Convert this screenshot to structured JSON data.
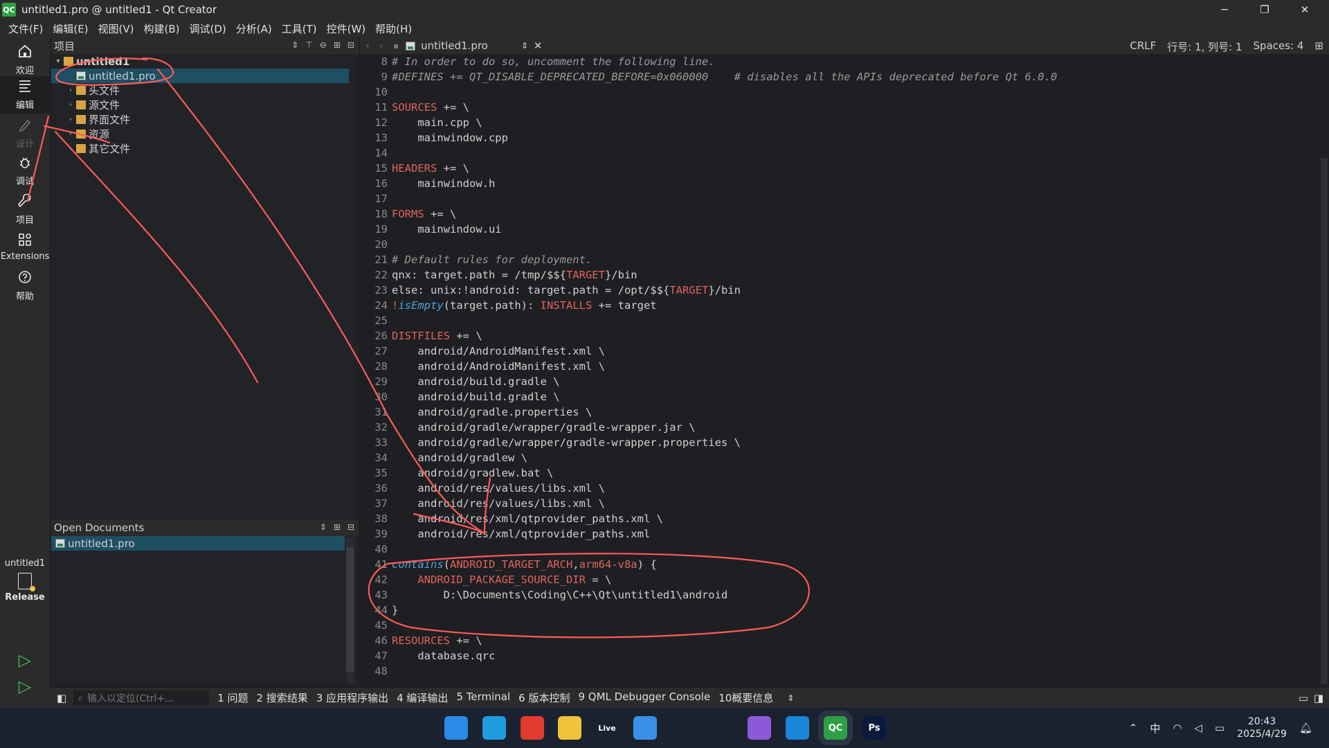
{
  "window": {
    "title": "untitled1.pro @ untitled1 - Qt Creator",
    "app_badge": "QC"
  },
  "menu": [
    "文件(F)",
    "编辑(E)",
    "视图(V)",
    "构建(B)",
    "调试(D)",
    "分析(A)",
    "工具(T)",
    "控件(W)",
    "帮助(H)"
  ],
  "modes": [
    {
      "label": "欢迎",
      "icon": "home-icon"
    },
    {
      "label": "编辑",
      "icon": "edit-lines-icon",
      "selected": true
    },
    {
      "label": "设计",
      "icon": "pencil-icon",
      "disabled": true
    },
    {
      "label": "调试",
      "icon": "bug-icon"
    },
    {
      "label": "项目",
      "icon": "wrench-icon"
    },
    {
      "label": "Extensions",
      "icon": "extensions-icon"
    },
    {
      "label": "帮助",
      "icon": "help-icon"
    }
  ],
  "kit": {
    "project": "untitled1",
    "config": "Release"
  },
  "project_panel": {
    "title": "项目",
    "tree": [
      {
        "label": "untitled1",
        "level": 0,
        "expanded": true,
        "type": "project"
      },
      {
        "label": "untitled1.pro",
        "level": 1,
        "type": "profile",
        "selected": true
      },
      {
        "label": "头文件",
        "level": 1,
        "type": "folder"
      },
      {
        "label": "源文件",
        "level": 1,
        "type": "folder"
      },
      {
        "label": "界面文件",
        "level": 1,
        "type": "folder"
      },
      {
        "label": "资源",
        "level": 1,
        "type": "folder"
      },
      {
        "label": "其它文件",
        "level": 1,
        "type": "folder"
      }
    ]
  },
  "open_documents": {
    "title": "Open Documents",
    "items": [
      "untitled1.pro"
    ]
  },
  "editor": {
    "tab": "untitled1.pro",
    "line_ending": "CRLF",
    "position": "行号: 1, 列号: 1",
    "spaces": "Spaces: 4",
    "lines": [
      {
        "n": "8",
        "t": "# In order to do so, uncomment the following line."
      },
      {
        "n": "9",
        "t": "#DEFINES += QT_DISABLE_DEPRECATED_BEFORE=0x060000    # disables all the APIs deprecated before Qt 6.0.0"
      },
      {
        "n": "10",
        "t": ""
      },
      {
        "n": "11",
        "t": "SOURCES += \\"
      },
      {
        "n": "12",
        "t": "    main.cpp \\"
      },
      {
        "n": "13",
        "t": "    mainwindow.cpp"
      },
      {
        "n": "14",
        "t": ""
      },
      {
        "n": "15",
        "t": "HEADERS += \\"
      },
      {
        "n": "16",
        "t": "    mainwindow.h"
      },
      {
        "n": "17",
        "t": ""
      },
      {
        "n": "18",
        "t": "FORMS += \\"
      },
      {
        "n": "19",
        "t": "    mainwindow.ui"
      },
      {
        "n": "20",
        "t": ""
      },
      {
        "n": "21",
        "t": "# Default rules for deployment."
      },
      {
        "n": "22",
        "t": "qnx: target.path = /tmp/$${TARGET}/bin"
      },
      {
        "n": "23",
        "t": "else: unix:!android: target.path = /opt/$${TARGET}/bin"
      },
      {
        "n": "24",
        "t": "!isEmpty(target.path): INSTALLS += target"
      },
      {
        "n": "25",
        "t": ""
      },
      {
        "n": "26",
        "t": "DISTFILES += \\"
      },
      {
        "n": "27",
        "t": "    android/AndroidManifest.xml \\"
      },
      {
        "n": "28",
        "t": "    android/AndroidManifest.xml \\"
      },
      {
        "n": "29",
        "t": "    android/build.gradle \\"
      },
      {
        "n": "30",
        "t": "    android/build.gradle \\"
      },
      {
        "n": "31",
        "t": "    android/gradle.properties \\"
      },
      {
        "n": "32",
        "t": "    android/gradle/wrapper/gradle-wrapper.jar \\"
      },
      {
        "n": "33",
        "t": "    android/gradle/wrapper/gradle-wrapper.properties \\"
      },
      {
        "n": "34",
        "t": "    android/gradlew \\"
      },
      {
        "n": "35",
        "t": "    android/gradlew.bat \\"
      },
      {
        "n": "36",
        "t": "    android/res/values/libs.xml \\"
      },
      {
        "n": "37",
        "t": "    android/res/values/libs.xml \\"
      },
      {
        "n": "38",
        "t": "    android/res/xml/qtprovider_paths.xml \\"
      },
      {
        "n": "39",
        "t": "    android/res/xml/qtprovider_paths.xml"
      },
      {
        "n": "40",
        "t": ""
      },
      {
        "n": "41",
        "t": "contains(ANDROID_TARGET_ARCH,arm64-v8a) {"
      },
      {
        "n": "42",
        "t": "    ANDROID_PACKAGE_SOURCE_DIR = \\"
      },
      {
        "n": "43",
        "t": "        D:\\Documents\\Coding\\C++\\Qt\\untitled1\\android"
      },
      {
        "n": "44",
        "t": "}"
      },
      {
        "n": "45",
        "t": ""
      },
      {
        "n": "46",
        "t": "RESOURCES += \\"
      },
      {
        "n": "47",
        "t": "    database.qrc"
      },
      {
        "n": "48",
        "t": ""
      }
    ]
  },
  "statusbar": {
    "locator_placeholder": "输入以定位(Ctrl+...",
    "panes": [
      "1 问题",
      "2 搜索结果",
      "3 应用程序输出",
      "4 编译输出",
      "5 Terminal",
      "6 版本控制",
      "9 QML Debugger Console",
      "10概要信息"
    ]
  },
  "taskbar": {
    "apps": [
      {
        "name": "windows-start-icon",
        "label": "",
        "color": "#2a8ae6"
      },
      {
        "name": "edge-icon",
        "label": "",
        "color": "#1f9be0"
      },
      {
        "name": "netease-music-icon",
        "label": "",
        "color": "#e33a2f"
      },
      {
        "name": "file-explorer-icon",
        "label": "",
        "color": "#f2c23a"
      },
      {
        "name": "live-icon",
        "label": "Live",
        "color": "#1a2230"
      },
      {
        "name": "shield-app-icon",
        "label": "",
        "color": "#3b8fe8"
      },
      {
        "name": "steam-icon",
        "label": "",
        "color": "#1a2230"
      },
      {
        "name": "unity-icon",
        "label": "",
        "color": "#1a2230"
      },
      {
        "name": "visual-studio-icon",
        "label": "",
        "color": "#8c5ad8"
      },
      {
        "name": "vscode-icon",
        "label": "",
        "color": "#1a86d8"
      },
      {
        "name": "qt-creator-icon",
        "label": "QC",
        "color": "#2ea043"
      },
      {
        "name": "photoshop-icon",
        "label": "Ps",
        "color": "#0b1a3a"
      }
    ],
    "ime": "中",
    "time": "20:43",
    "date": "2025/4/29"
  }
}
